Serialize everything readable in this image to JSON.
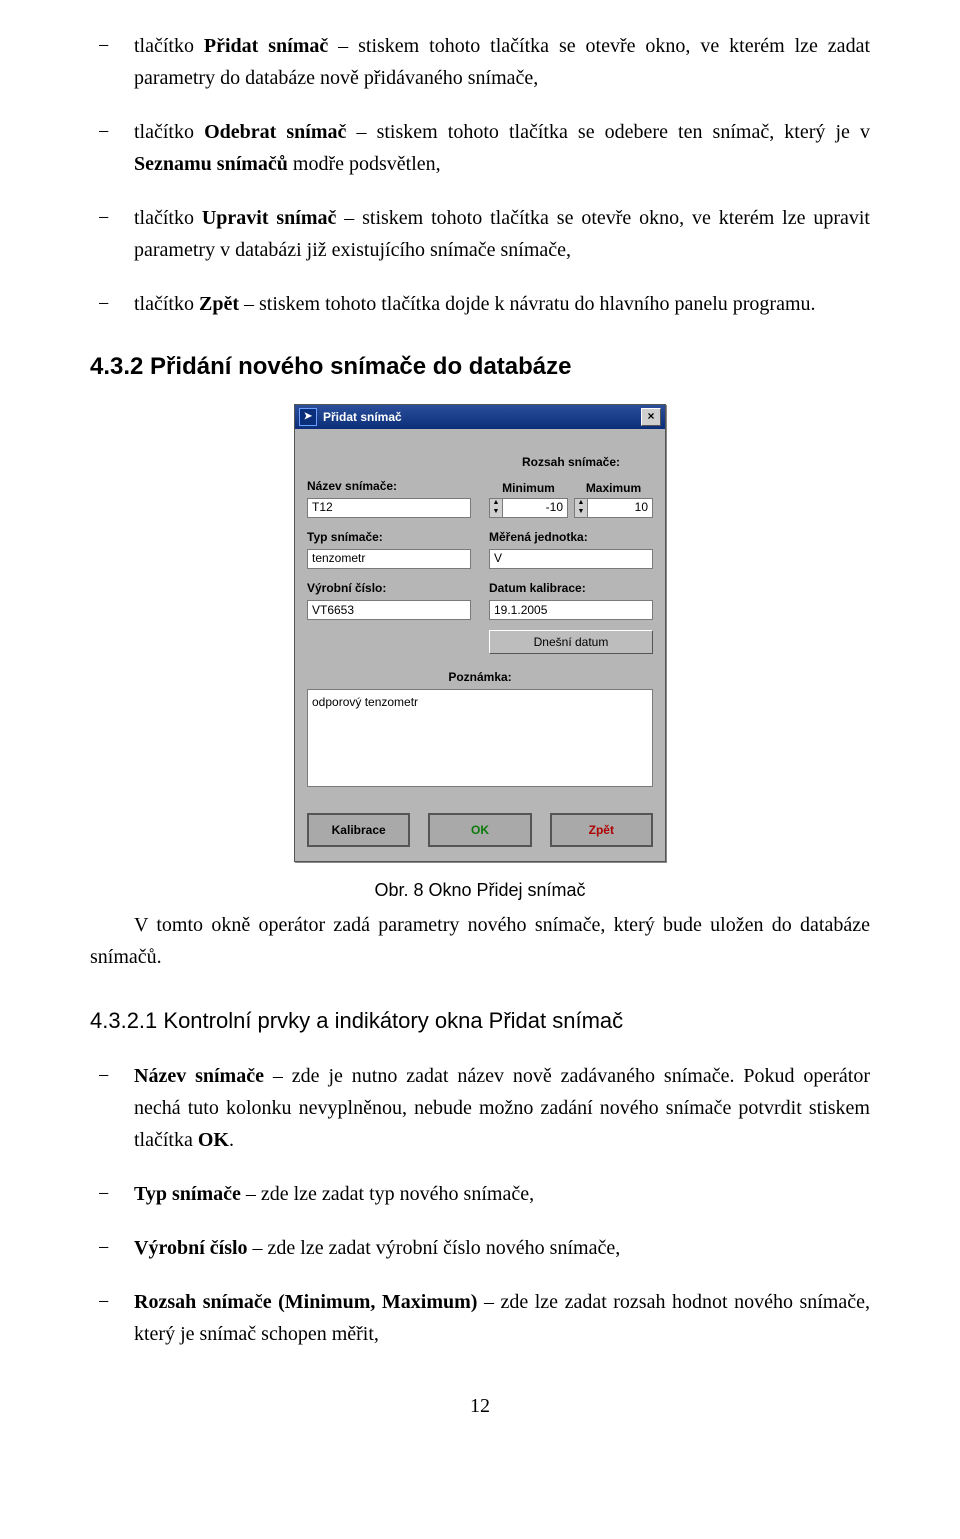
{
  "bullets_top": [
    {
      "b": "Přidat snímač",
      "text": " – stiskem tohoto tlačítka se otevře okno, ve kterém lze zadat parametry do databáze nově přidávaného snímače,",
      "lead": "tlačítko "
    },
    {
      "b": "Odebrat snímač",
      "text": " – stiskem tohoto tlačítka se odebere ten snímač, který je v ",
      "lead": "tlačítko ",
      "tail_b": "Seznamu snímačů",
      "tail": " modře podsvětlen,"
    },
    {
      "b": "Upravit snímač",
      "text": " – stiskem tohoto tlačítka se otevře okno, ve kterém lze upravit parametry v databázi již existujícího snímače snímače,",
      "lead": "tlačítko "
    },
    {
      "b": "Zpět",
      "text": " – stiskem tohoto tlačítka dojde k návratu do hlavního panelu programu.",
      "lead": "tlačítko "
    }
  ],
  "h2": "4.3.2  Přidání nového snímače do databáze",
  "dialog": {
    "title": "Přidat snímač",
    "labels": {
      "nazev": "Název snímače:",
      "rozsah": "Rozsah snímače:",
      "min": "Minimum",
      "max": "Maximum",
      "typ": "Typ snímače:",
      "jednotka": "Měřená jednotka:",
      "vyrobni": "Výrobní číslo:",
      "datum": "Datum kalibrace:",
      "dnesni": "Dnešní datum",
      "poznamka": "Poznámka:",
      "kalibrace": "Kalibrace",
      "ok": "OK",
      "zpet": "Zpět"
    },
    "values": {
      "nazev": "T12",
      "min": "-10",
      "max": "10",
      "typ": "tenzometr",
      "jednotka": "V",
      "vyrobni": "VT6653",
      "datum": "19.1.2005",
      "poznamka": "odporový tenzometr"
    }
  },
  "caption": "Obr. 8   Okno Přidej snímač",
  "para_after": "V tomto okně operátor zadá parametry nového snímače, který bude uložen do databáze snímačů.",
  "h3": "4.3.2.1     Kontrolní prvky a indikátory okna Přidat snímač",
  "bullets_bottom": [
    {
      "b": "Název snímače",
      "text": " – zde je nutno zadat název nově zadávaného snímače. Pokud operátor nechá tuto kolonku nevyplněnou, nebude možno zadání nového snímače potvrdit stiskem tlačítka ",
      "tail_b": "OK",
      "tail": "."
    },
    {
      "b": "Typ snímače",
      "text": " – zde lze zadat typ nového snímače,"
    },
    {
      "b": "Výrobní číslo",
      "text": " – zde lze zadat výrobní číslo nového snímače,"
    },
    {
      "b": "Rozsah snímače (Minimum, Maximum)",
      "text": " – zde lze zadat rozsah hodnot nového snímače, který je snímač schopen měřit,"
    }
  ],
  "page": "12"
}
